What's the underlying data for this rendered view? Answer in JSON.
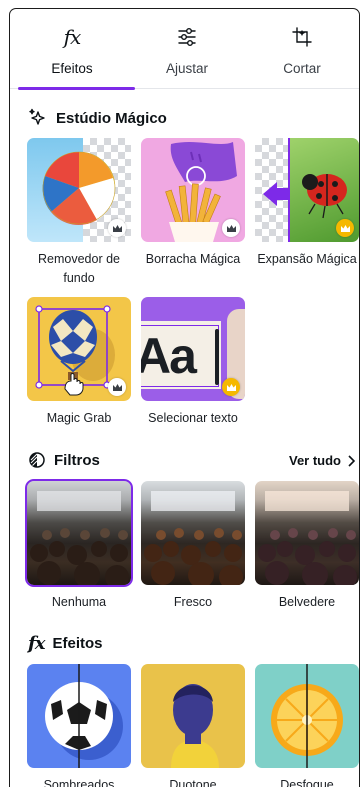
{
  "tabs": [
    {
      "label": "Efeitos",
      "icon": "fx-icon",
      "active": true
    },
    {
      "label": "Ajustar",
      "icon": "sliders-icon",
      "active": false
    },
    {
      "label": "Cortar",
      "icon": "crop-icon",
      "active": false
    }
  ],
  "magic_studio": {
    "title": "Estúdio Mágico",
    "icon": "sparkle-icon",
    "tools": [
      {
        "label": "Removedor de fundo",
        "premium": true
      },
      {
        "label": "Borracha Mágica",
        "premium": true
      },
      {
        "label": "Expansão Mágica",
        "premium": true
      },
      {
        "label": "Magic Grab",
        "premium": true
      },
      {
        "label": "Selecionar texto",
        "premium": true
      }
    ]
  },
  "filters": {
    "title": "Filtros",
    "icon": "filters-icon",
    "see_all": "Ver tudo",
    "items": [
      {
        "label": "Nenhuma",
        "selected": true
      },
      {
        "label": "Fresco",
        "selected": false
      },
      {
        "label": "Belvedere",
        "selected": false
      }
    ]
  },
  "effects": {
    "title": "Efeitos",
    "icon": "fx-icon",
    "items": [
      {
        "label": "Sombreados"
      },
      {
        "label": "Duotone"
      },
      {
        "label": "Desfoque"
      }
    ]
  },
  "sample_text": "Aa",
  "colors": {
    "accent": "#7d2ae8",
    "premium_gold": "#f5b800"
  }
}
